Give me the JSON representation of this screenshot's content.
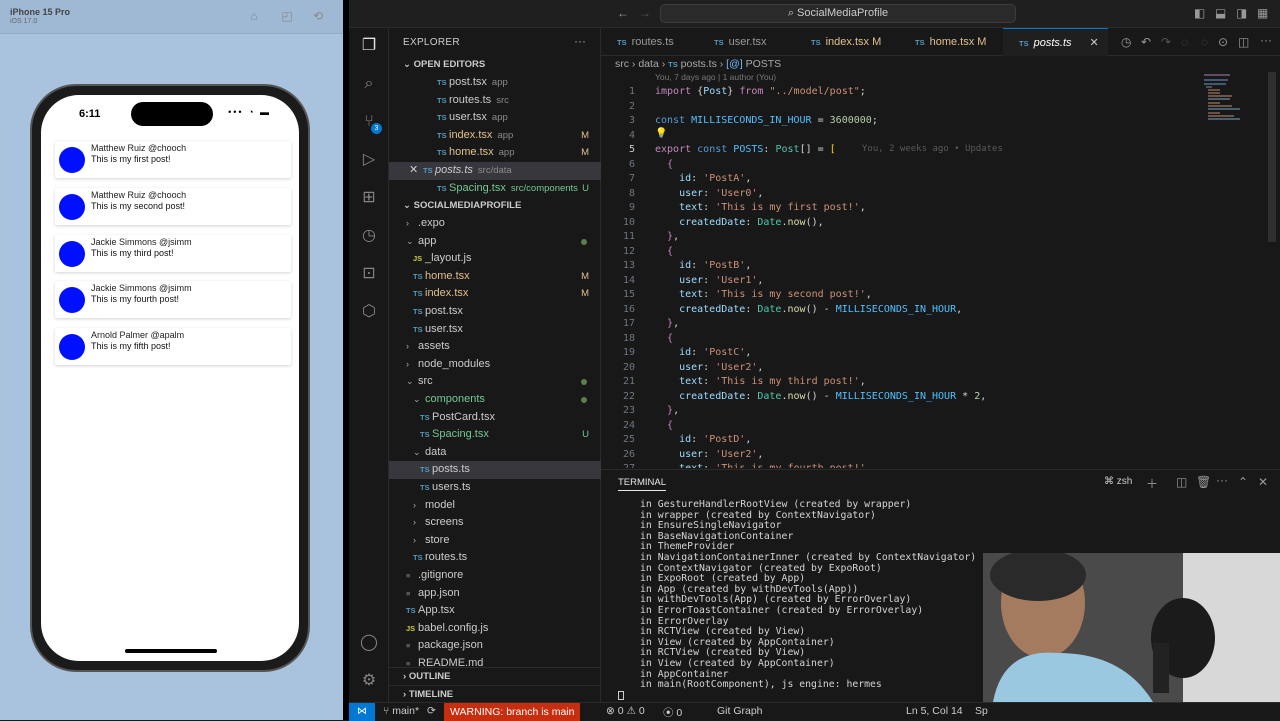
{
  "simulator": {
    "device": "iPhone 15 Pro",
    "os": "iOS 17.0"
  },
  "phone": {
    "clock": "6:11",
    "posts": [
      {
        "user": "Matthew Ruiz @chooch",
        "text": "This is my first post!"
      },
      {
        "user": "Matthew Ruiz @chooch",
        "text": "This is my second post!"
      },
      {
        "user": "Jackie Simmons @jsimm",
        "text": "This is my third post!"
      },
      {
        "user": "Jackie Simmons @jsimm",
        "text": "This is my fourth post!"
      },
      {
        "user": "Arnold Palmer @apalm",
        "text": "This is my fifth post!"
      }
    ]
  },
  "titlebar": {
    "search": "SocialMediaProfile"
  },
  "explorer": {
    "header": "EXPLORER",
    "open_editors": "OPEN EDITORS",
    "open": [
      {
        "name": "post.tsx",
        "desc": "app",
        "status": ""
      },
      {
        "name": "routes.ts",
        "desc": "src",
        "status": ""
      },
      {
        "name": "user.tsx",
        "desc": "app",
        "status": ""
      },
      {
        "name": "index.tsx",
        "desc": "app",
        "status": "M"
      },
      {
        "name": "home.tsx",
        "desc": "app",
        "status": "M"
      },
      {
        "name": "posts.ts",
        "desc": "src/data",
        "status": ""
      },
      {
        "name": "Spacing.tsx",
        "desc": "src/components",
        "status": "U"
      }
    ],
    "project": "SOCIALMEDIAPROFILE",
    "tree": [
      {
        "name": ".expo",
        "kind": "folder-closed"
      },
      {
        "name": "app",
        "kind": "folder-open"
      },
      {
        "name": "_layout.js",
        "kind": "js"
      },
      {
        "name": "home.tsx",
        "kind": "ts",
        "status": "M"
      },
      {
        "name": "index.tsx",
        "kind": "ts",
        "status": "M"
      },
      {
        "name": "post.tsx",
        "kind": "ts"
      },
      {
        "name": "user.tsx",
        "kind": "ts"
      },
      {
        "name": "assets",
        "kind": "folder-closed"
      },
      {
        "name": "node_modules",
        "kind": "folder-closed"
      },
      {
        "name": "src",
        "kind": "folder-open"
      },
      {
        "name": "components",
        "kind": "folder-open"
      },
      {
        "name": "PostCard.tsx",
        "kind": "ts"
      },
      {
        "name": "Spacing.tsx",
        "kind": "ts",
        "status": "U"
      },
      {
        "name": "data",
        "kind": "folder-open"
      },
      {
        "name": "posts.ts",
        "kind": "ts"
      },
      {
        "name": "users.ts",
        "kind": "ts"
      },
      {
        "name": "model",
        "kind": "folder-closed"
      },
      {
        "name": "screens",
        "kind": "folder-closed"
      },
      {
        "name": "store",
        "kind": "folder-closed"
      },
      {
        "name": "routes.ts",
        "kind": "ts"
      },
      {
        "name": ".gitignore",
        "kind": "file"
      },
      {
        "name": "app.json",
        "kind": "file"
      },
      {
        "name": "App.tsx",
        "kind": "ts"
      },
      {
        "name": "babel.config.js",
        "kind": "js"
      },
      {
        "name": "package.json",
        "kind": "file"
      },
      {
        "name": "README.md",
        "kind": "file"
      }
    ],
    "outline": "OUTLINE",
    "timeline": "TIMELINE"
  },
  "tabs": [
    {
      "name": "routes.ts",
      "status": ""
    },
    {
      "name": "user.tsx",
      "status": ""
    },
    {
      "name": "index.tsx",
      "status": "M"
    },
    {
      "name": "home.tsx",
      "status": "M"
    },
    {
      "name": "posts.ts",
      "status": ""
    }
  ],
  "breadcrumb": {
    "p1": "src",
    "p2": "data",
    "p3": "posts.ts",
    "p4": "POSTS"
  },
  "blame_header": "You, 7 days ago | 1 author (You)",
  "inline_blame": "You, 2 weeks ago • Updates",
  "terminal": {
    "title": "TERMINAL",
    "shell": "zsh",
    "lines": [
      "in GestureHandlerRootView (created by wrapper)",
      "in wrapper (created by ContextNavigator)",
      "in EnsureSingleNavigator",
      "in BaseNavigationContainer",
      "in ThemeProvider",
      "in NavigationContainerInner (created by ContextNavigator)",
      "in ContextNavigator (created by ExpoRoot)",
      "in ExpoRoot (created by App)",
      "in App (created by withDevTools(App))",
      "in withDevTools(App) (created by ErrorOverlay)",
      "in ErrorToastContainer (created by ErrorOverlay)",
      "in ErrorOverlay",
      "in RCTView (created by View)",
      "in View (created by AppContainer)",
      "in RCTView (created by View)",
      "in View (created by AppContainer)",
      "in AppContainer",
      "in main(RootComponent), js engine: hermes"
    ]
  },
  "status": {
    "branch": "main*",
    "warning": "WARNING: branch is main",
    "errors": "0",
    "warnings": "0",
    "ports": "0",
    "git_graph": "Git Graph",
    "position": "Ln 5, Col 14",
    "extra": "Sp"
  }
}
